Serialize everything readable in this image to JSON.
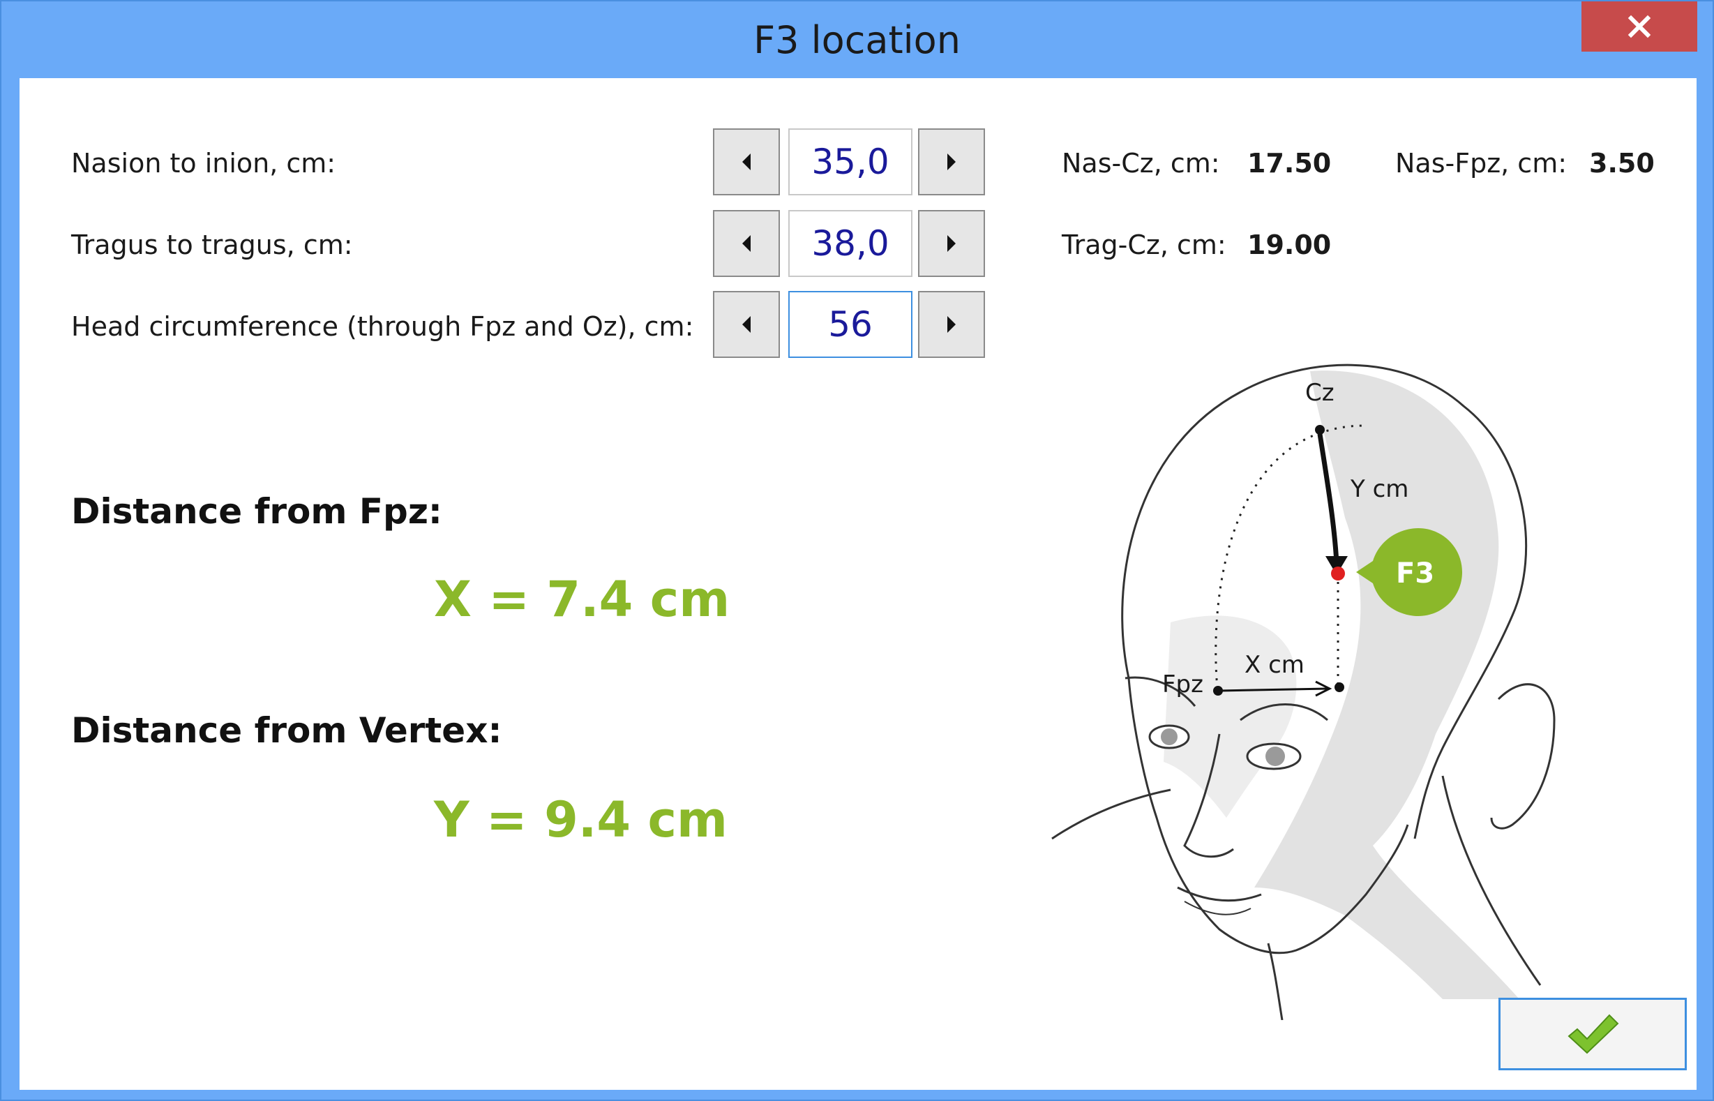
{
  "window": {
    "title": "F3 location"
  },
  "inputs": [
    {
      "label": "Nasion to inion, cm:",
      "value": "35,0"
    },
    {
      "label": "Tragus to tragus, cm:",
      "value": "38,0"
    },
    {
      "label": "Head circumference (through Fpz and Oz), cm:",
      "value": "56"
    }
  ],
  "calc": {
    "nas_cz_label": "Nas-Cz, cm:",
    "nas_cz_value": "17.50",
    "nas_fpz_label": "Nas-Fpz, cm:",
    "nas_fpz_value": "3.50",
    "trag_cz_label": "Trag-Cz, cm:",
    "trag_cz_value": "19.00"
  },
  "results": {
    "fpz_heading": "Distance from Fpz:",
    "x_value": "X = 7.4 cm",
    "vertex_heading": "Distance from Vertex:",
    "y_value": "Y = 9.4 cm"
  },
  "figure": {
    "cz_label": "Cz",
    "fpz_label": "Fpz",
    "y_label": "Y cm",
    "x_label": "X cm",
    "badge_label": "F3",
    "accent_color": "#8bb82a",
    "point_color": "#e02020"
  },
  "icons": {
    "close": "close-icon",
    "ok": "checkmark-icon",
    "decrement": "arrow-left-icon",
    "increment": "arrow-right-icon"
  }
}
